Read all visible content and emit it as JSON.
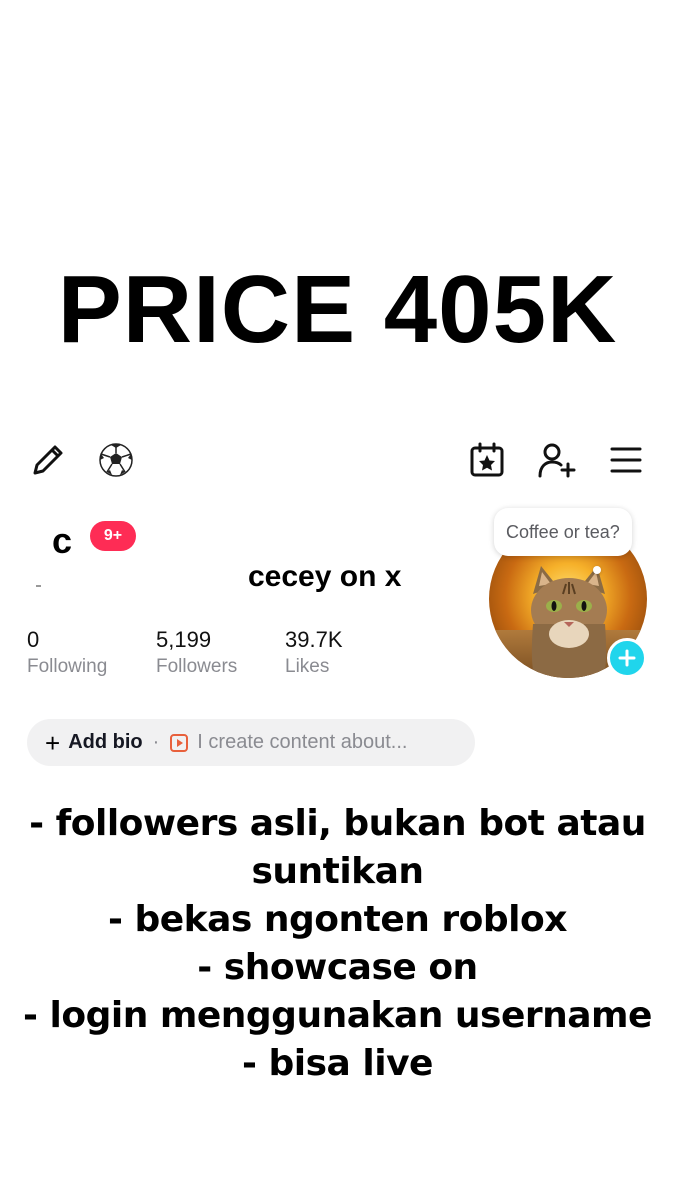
{
  "price_title": "PRICE 405K",
  "topbar": {
    "left_icons": [
      "pencil-icon",
      "soccer-ball-icon"
    ],
    "right_icons": [
      "calendar-star-icon",
      "add-user-icon",
      "menu-icon"
    ]
  },
  "profile": {
    "username_partial": "c",
    "notification_badge": "9+",
    "display_name": "cecey on x",
    "stats": [
      {
        "value": "0",
        "label": "Following"
      },
      {
        "value": "5,199",
        "label": "Followers"
      },
      {
        "value": "39.7K",
        "label": "Likes"
      }
    ],
    "bubble_text": "Coffee or tea?",
    "avatar_plus_icon": "plus-icon",
    "accent_color": "#20d5ec",
    "badge_color": "#fe2c55"
  },
  "bio": {
    "add_label": "Add bio",
    "separator": "·",
    "hint": "I create content about..."
  },
  "description": [
    "- followers asli, bukan bot atau",
    "suntikan",
    "- bekas ngonten roblox",
    "- showcase on",
    "- login menggunakan username",
    "- bisa live"
  ]
}
